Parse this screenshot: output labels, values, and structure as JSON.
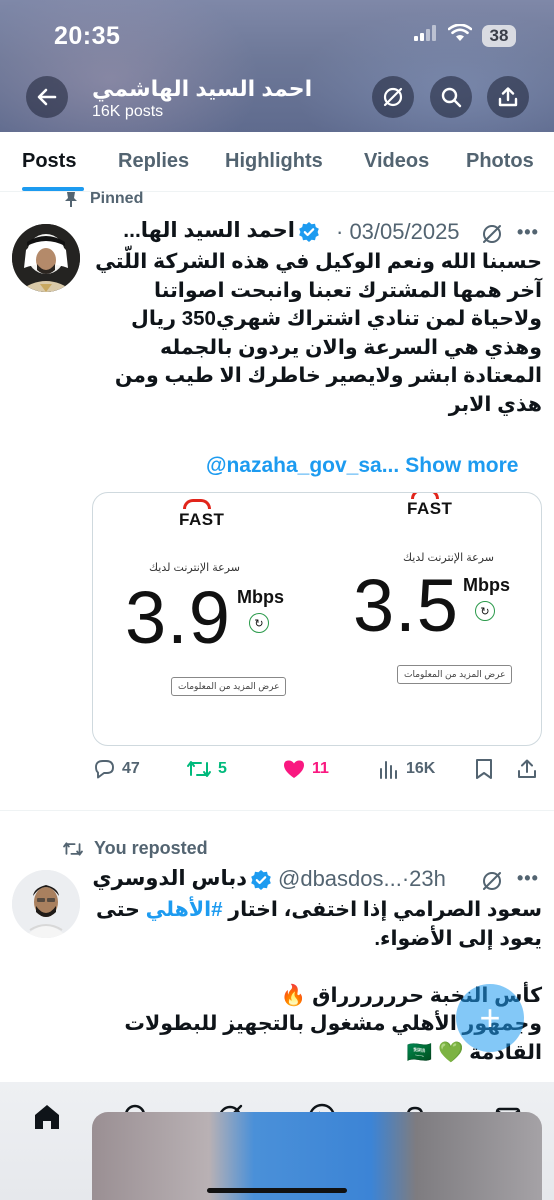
{
  "status_bar": {
    "time": "20:35",
    "battery": "38"
  },
  "profile_header": {
    "name": "احمد السيد الهاشمي",
    "posts_count": "16K posts"
  },
  "tabs": [
    {
      "label": "Posts",
      "active": true
    },
    {
      "label": "Replies",
      "active": false
    },
    {
      "label": "Highlights",
      "active": false
    },
    {
      "label": "Videos",
      "active": false
    },
    {
      "label": "Photos",
      "active": false
    }
  ],
  "pinned_post": {
    "pinned_label": "Pinned",
    "author_name": "احمد السيد الها...",
    "date": "· 03/05/2025",
    "text": "حسبنا الله ونعم الوكيل في هذه الشركة اللّتي\nآخر همها المشترك تعبنا وانبحت اصواتنا\nولاحياة لمن تنادي اشتراك شهري350 ريال\nوهذي هي السرعة والان يردون بالجمله\nالمعتادة ابشر ولايصير خاطرك الا طيب ومن\nهذي الابر",
    "mention": "@nazaha_gov_sa...",
    "show_more": "Show more",
    "media": {
      "left_card": {
        "brand": "FAST",
        "label": "سرعة الإنترنت لديك",
        "speed": "3.9",
        "unit": "Mbps",
        "more_info": "عرض المزيد من المعلومات"
      },
      "right_card": {
        "brand": "FAST",
        "label": "سرعة الإنترنت لديك",
        "speed": "3.5",
        "unit": "Mbps",
        "more_info": "عرض المزيد من المعلومات"
      }
    },
    "stats": {
      "replies": "47",
      "reposts": "5",
      "likes": "11",
      "views": "16K"
    }
  },
  "reposted_post": {
    "repost_label": "You reposted",
    "author_name": "دباس الدوسري",
    "handle": "@dbasdos...",
    "time": "·23h",
    "text_line1": "سعود الصرامي إذا اختفى، اختار ",
    "hashtag": "#الأهلي",
    "text_line1_end": " حتى",
    "text_rest": "يعود إلى الأضواء.\n\nكأس النخبة حرررررراق 🔥\nوجمهور الأهلي مشغول بالتجهيز للبطولات\nالقادمة 💚 🇸🇦"
  },
  "compose_button": {
    "label": "+"
  },
  "bottom_nav": [
    "home-icon",
    "search-icon",
    "grok-icon",
    "video-icon",
    "notifications-icon",
    "messages-icon"
  ],
  "colors": {
    "accent": "#1d9bf0",
    "like": "#f91880",
    "repost": "#00ba7c",
    "secondary_text": "#536471"
  }
}
